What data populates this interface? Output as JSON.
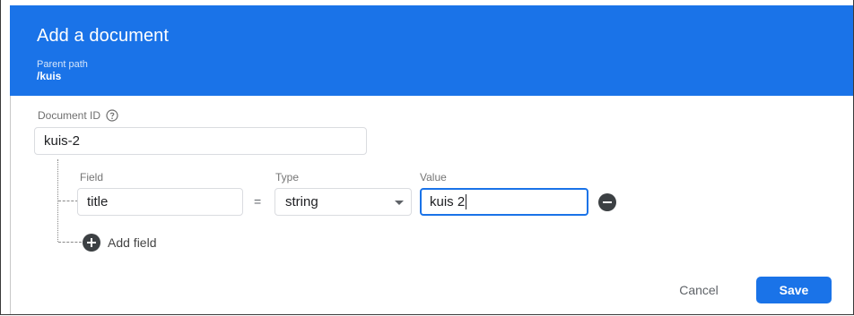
{
  "dialog": {
    "title": "Add a document",
    "parent_path_label": "Parent path",
    "parent_path_value": "/kuis"
  },
  "document_id": {
    "label": "Document ID",
    "value": "kuis-2",
    "help_icon": "help-circle-icon"
  },
  "fields": {
    "headers": {
      "field": "Field",
      "type": "Type",
      "value": "Value"
    },
    "rows": [
      {
        "name": "title",
        "operator": "=",
        "type": "string",
        "value": "kuis 2"
      }
    ],
    "add_label": "Add field"
  },
  "actions": {
    "cancel": "Cancel",
    "save": "Save"
  },
  "colors": {
    "accent": "#1a73e8",
    "icon_dark": "#3c4043"
  }
}
